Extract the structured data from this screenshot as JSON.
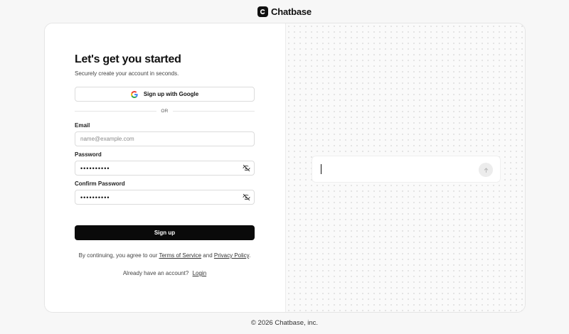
{
  "brand": {
    "name": "Chatbase",
    "logo_icon": "chatbase-logo-icon"
  },
  "signup": {
    "heading": "Let's get you started",
    "subheading": "Securely create your account in seconds.",
    "google_button": "Sign up with Google",
    "divider": "OR",
    "email_label": "Email",
    "email_placeholder": "name@example.com",
    "email_value": "",
    "password_label": "Password",
    "password_value": "••••••••••",
    "confirm_label": "Confirm Password",
    "confirm_value": "••••••••••",
    "submit": "Sign up",
    "terms_prefix": "By continuing, you agree to our",
    "terms_link": "Terms of Service",
    "terms_and": "and",
    "privacy_link": "Privacy Policy",
    "terms_suffix": ".",
    "login_prompt": "Already have an account?",
    "login_link": "Login"
  },
  "preview": {
    "send_icon": "arrow-up-icon"
  },
  "footer": {
    "copyright": "© 2026 Chatbase, inc."
  },
  "colors": {
    "primary": "#0a0a0a",
    "background": "#f7f7f7",
    "card": "#ffffff",
    "border": "#e5e5e5"
  }
}
